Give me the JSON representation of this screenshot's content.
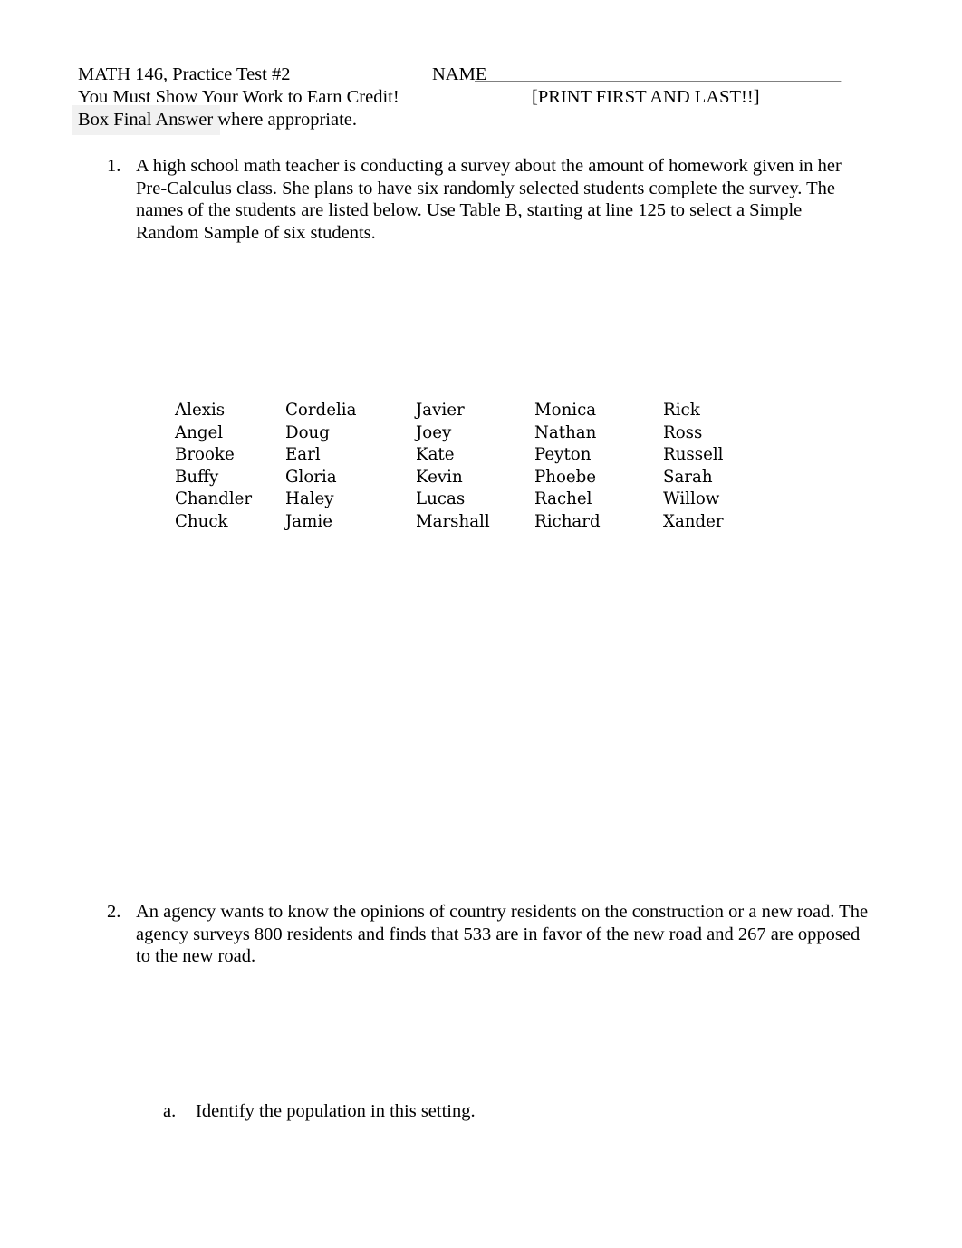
{
  "document": {
    "header": {
      "course_title": "MATH 146, Practice Test #2",
      "name_label": "NAME",
      "name_blank": "_________________________________________",
      "instruction_work": "You Must Show Your Work to Earn Credit!",
      "print_note": "[PRINT FIRST AND LAST!!]",
      "instruction_box": "Box Final Answer where appropriate."
    },
    "questions": [
      {
        "number": "1.",
        "lines": [
          "A high school math teacher is conducting a survey about the amount of homework given in her",
          "Pre-Calculus class. She plans to have six randomly selected students complete the survey. The",
          "names of the students are listed below. Use Table B, starting at line 125 to select a Simple",
          "Random Sample of six students."
        ]
      },
      {
        "number": "2.",
        "lines": [
          "An agency wants to know the opinions of country residents on the construction or a new road. The",
          "agency surveys 800 residents and finds that 533 are in favor of the new road and 267 are opposed",
          "to the new road."
        ]
      }
    ],
    "subquestions": [
      {
        "letter": "a.",
        "text": "Identify the population in this setting."
      }
    ],
    "student_names": {
      "rows": [
        [
          "Alexis",
          "Cordelia",
          "Javier",
          "Monica",
          "Rick"
        ],
        [
          "Angel",
          "Doug",
          "Joey",
          "Nathan",
          "Ross"
        ],
        [
          "Brooke",
          "Earl",
          "Kate",
          "Peyton",
          "Russell"
        ],
        [
          "Buffy",
          "Gloria",
          "Kevin",
          "Phoebe",
          "Sarah"
        ],
        [
          "Chandler",
          "Haley",
          "Lucas",
          "Rachel",
          "Willow"
        ],
        [
          "Chuck",
          "Jamie",
          "Marshall",
          "Richard",
          "Xander"
        ]
      ]
    },
    "colors": {
      "text": "#000000",
      "page_background": "#ffffff",
      "highlight": "#f1f1f1"
    }
  }
}
